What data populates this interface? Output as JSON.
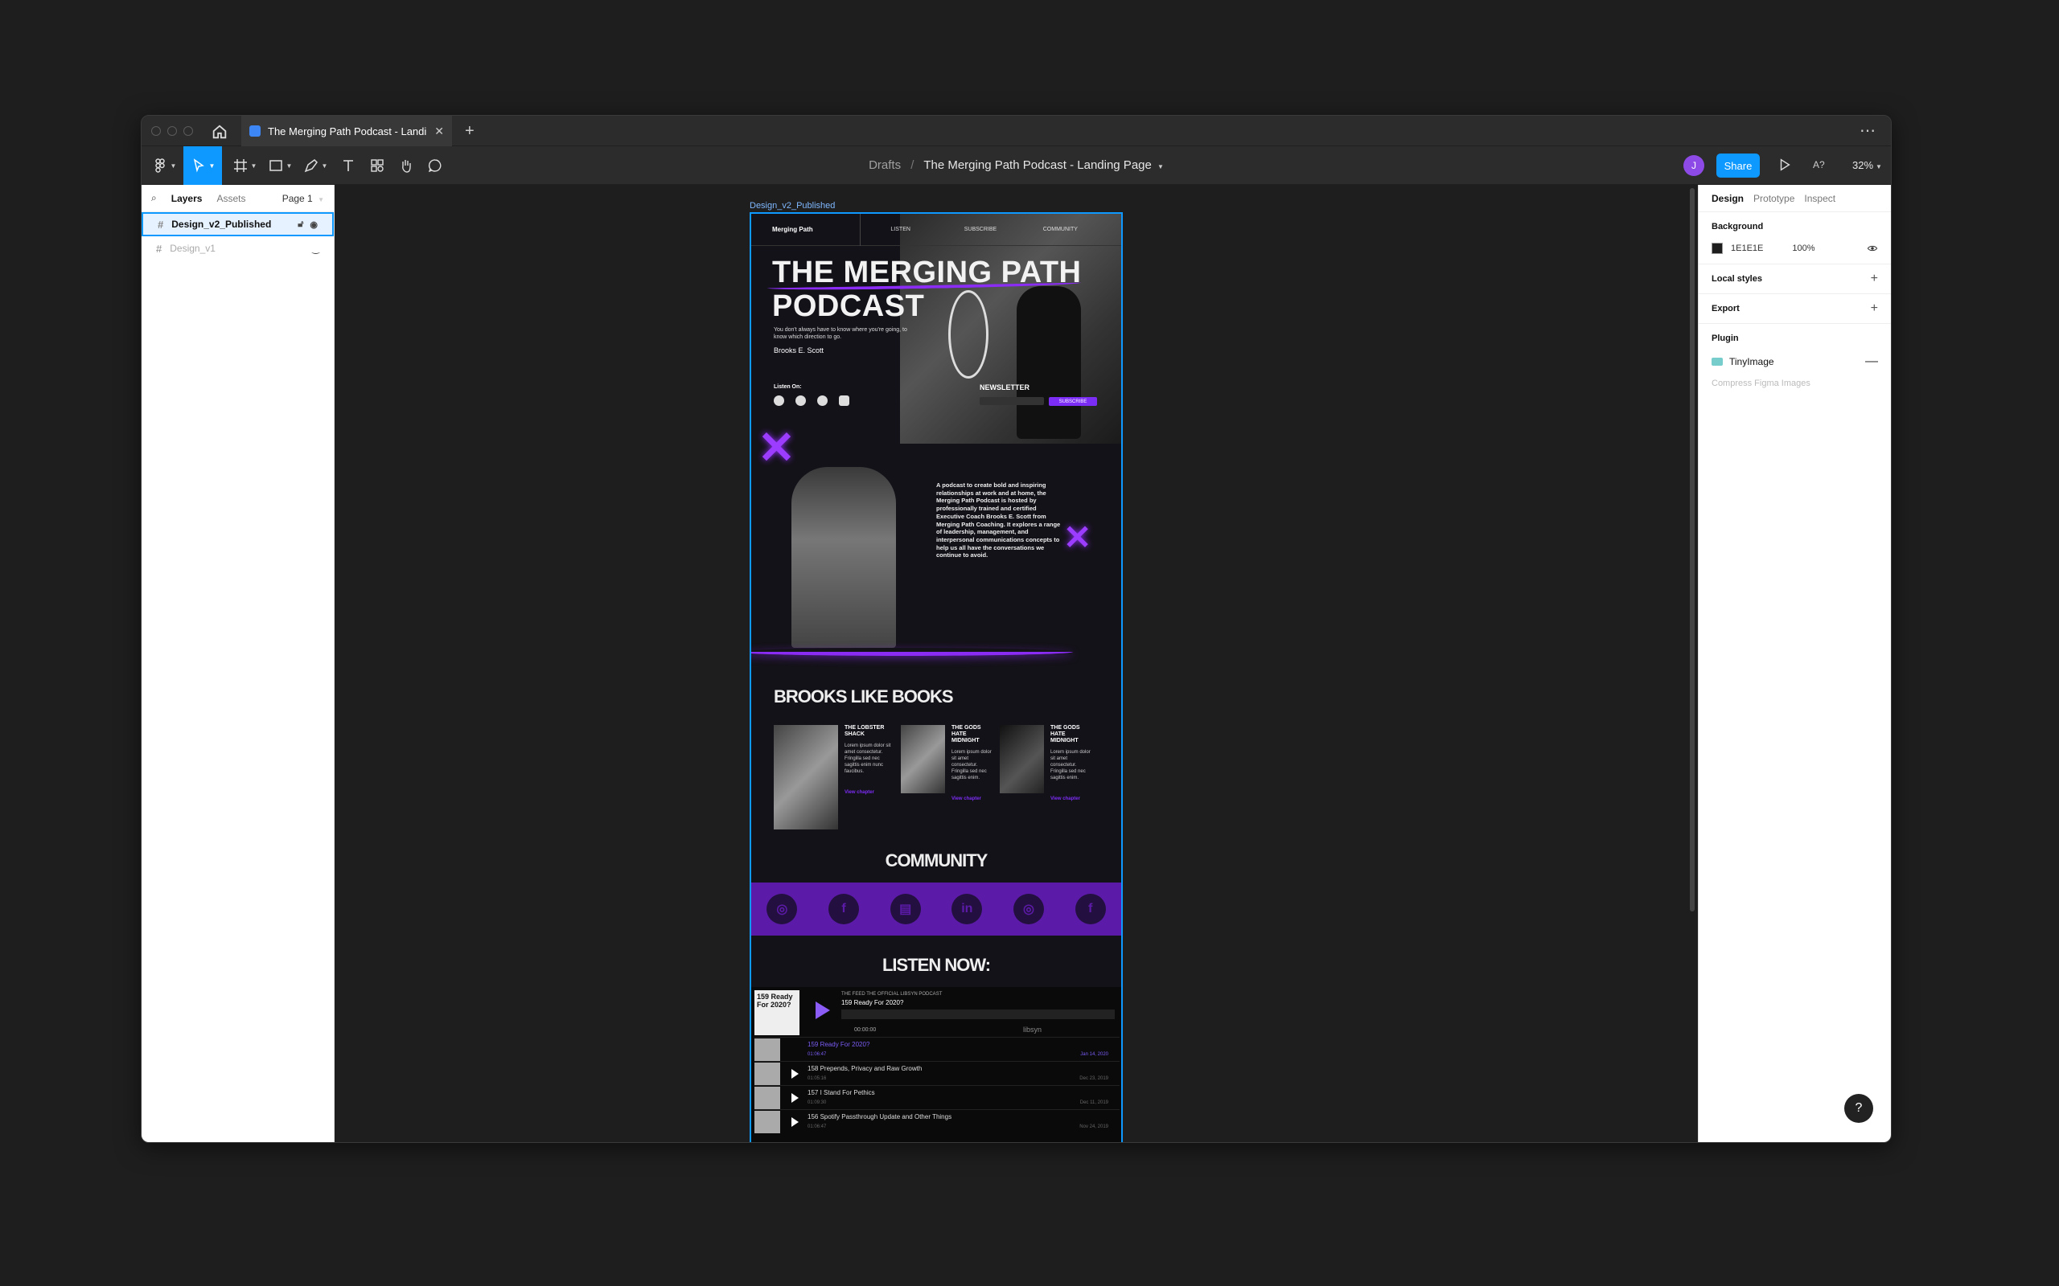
{
  "tab": {
    "title": "The Merging Path Podcast - Landing Page"
  },
  "breadcrumb": {
    "root": "Drafts",
    "separator": "/",
    "file": "The Merging Path Podcast - Landing Page"
  },
  "toolbar": {
    "avatar_initial": "J",
    "share_label": "Share",
    "a11y_label": "A?",
    "zoom": "32%"
  },
  "left_panel": {
    "tabs": [
      "Layers",
      "Assets"
    ],
    "page": "Page 1",
    "layers": [
      {
        "name": "Design_v2_Published",
        "selected": true
      },
      {
        "name": "Design_v1",
        "selected": false
      }
    ]
  },
  "right_panel": {
    "tabs": [
      "Design",
      "Prototype",
      "Inspect"
    ],
    "background": {
      "title": "Background",
      "hex": "1E1E1E",
      "opacity": "100%"
    },
    "local_styles": "Local styles",
    "export": "Export",
    "plugin": {
      "title": "Plugin",
      "name": "TinyImage",
      "hint": "Compress Figma Images"
    },
    "help": "?"
  },
  "frame": {
    "label": "Design_v2_Published",
    "nav": {
      "brand": "Merging Path",
      "links": [
        "LISTEN",
        "SUBSCRIBE",
        "COMMUNITY"
      ]
    },
    "hero": {
      "title_line1": "THE MERGING PATH",
      "title_line2": "PODCAST",
      "tagline": "You don't always have to know where you're going, to know which direction to go.",
      "author": "Brooks E. Scott",
      "listen_on": "Listen On:",
      "newsletter": "NEWSLETTER",
      "subscribe": "SUBSCRIBE"
    },
    "about": "A podcast to create bold and inspiring relationships at work and at home, the Merging Path Podcast is hosted by professionally trained and certified Executive Coach Brooks E. Scott from Merging Path Coaching. It explores a range of leadership, management, and interpersonal communications concepts to help us all have the conversations we continue to avoid.",
    "books_title": "BROOKS LIKE BOOKS",
    "books": [
      {
        "title": "THE LOBSTER SHACK",
        "desc": "Lorem ipsum dolor sit amet consectetur. Fringilla sed nec sagittis enim nunc faucibus.",
        "link": "View chapter"
      },
      {
        "title": "THE GODS HATE MIDNIGHT",
        "desc": "Lorem ipsum dolor sit amet consectetur. Fringilla sed nec sagittis enim.",
        "link": "View chapter"
      },
      {
        "title": "THE GODS HATE MIDNIGHT",
        "desc": "Lorem ipsum dolor sit amet consectetur. Fringilla sed nec sagittis enim.",
        "link": "View chapter"
      }
    ],
    "community_title": "COMMUNITY",
    "listen_title": "LISTEN NOW:",
    "player": {
      "cover_text": "159 Ready For 2020?",
      "source": "THE FEED THE OFFICIAL LIBSYN PODCAST",
      "title": "159 Ready For 2020?",
      "time": "00:00:00",
      "brand": "libsyn",
      "episodes": [
        {
          "title": "159 Ready For 2020?",
          "duration": "01:06:47",
          "date": "Jan 14, 2020",
          "current": true
        },
        {
          "title": "158 Prepends, Privacy and Raw Growth",
          "duration": "01:05:16",
          "date": "Dec 23, 2019",
          "current": false
        },
        {
          "title": "157 I Stand For Pethics",
          "duration": "01:09:30",
          "date": "Dec 11, 2019",
          "current": false
        },
        {
          "title": "156 Spotify Passthrough Update and Other Things",
          "duration": "01:06:47",
          "date": "Nov 24, 2019",
          "current": false
        }
      ]
    }
  },
  "colors": {
    "accent": "#0d99ff",
    "brand_purple": "#8b2cf5",
    "canvas": "#1e1e1e"
  }
}
